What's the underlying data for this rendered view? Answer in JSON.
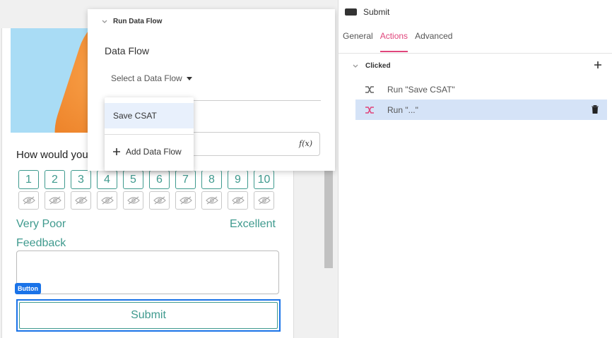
{
  "preview": {
    "question": "How would you",
    "ratings": [
      "1",
      "2",
      "3",
      "4",
      "5",
      "6",
      "7",
      "8",
      "9",
      "10"
    ],
    "scale_low": "Very Poor",
    "scale_high": "Excellent",
    "feedback_label": "Feedback",
    "button_tag": "Button",
    "submit_label": "Submit"
  },
  "popover": {
    "header": "Run Data Flow",
    "data_flow_label": "Data Flow",
    "select_placeholder": "Select a Data Flow",
    "dropdown": {
      "options": [
        "Save CSAT"
      ],
      "add_label": "Add Data Flow"
    },
    "fx_label": "f(x)"
  },
  "panel": {
    "title": "Submit",
    "tabs": [
      "General",
      "Actions",
      "Advanced"
    ],
    "active_tab": "Actions",
    "event_label": "Clicked",
    "actions": [
      {
        "label": "Run \"Save CSAT\""
      },
      {
        "label": "Run \"...\""
      }
    ]
  },
  "colors": {
    "accent": "#e0457b",
    "teal": "#3f9a8e",
    "selection": "#d5e3f7",
    "button_blue": "#1a73e8"
  }
}
